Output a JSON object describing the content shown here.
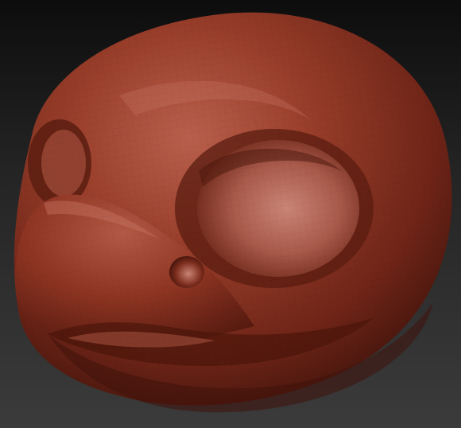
{
  "scene": {
    "subject_colors": {
      "base": "#8e3422",
      "highlight": "#c77463",
      "shadow": "#3f130b",
      "background_top": "#0d0d0d",
      "background_bottom": "#3b3b3b"
    }
  }
}
